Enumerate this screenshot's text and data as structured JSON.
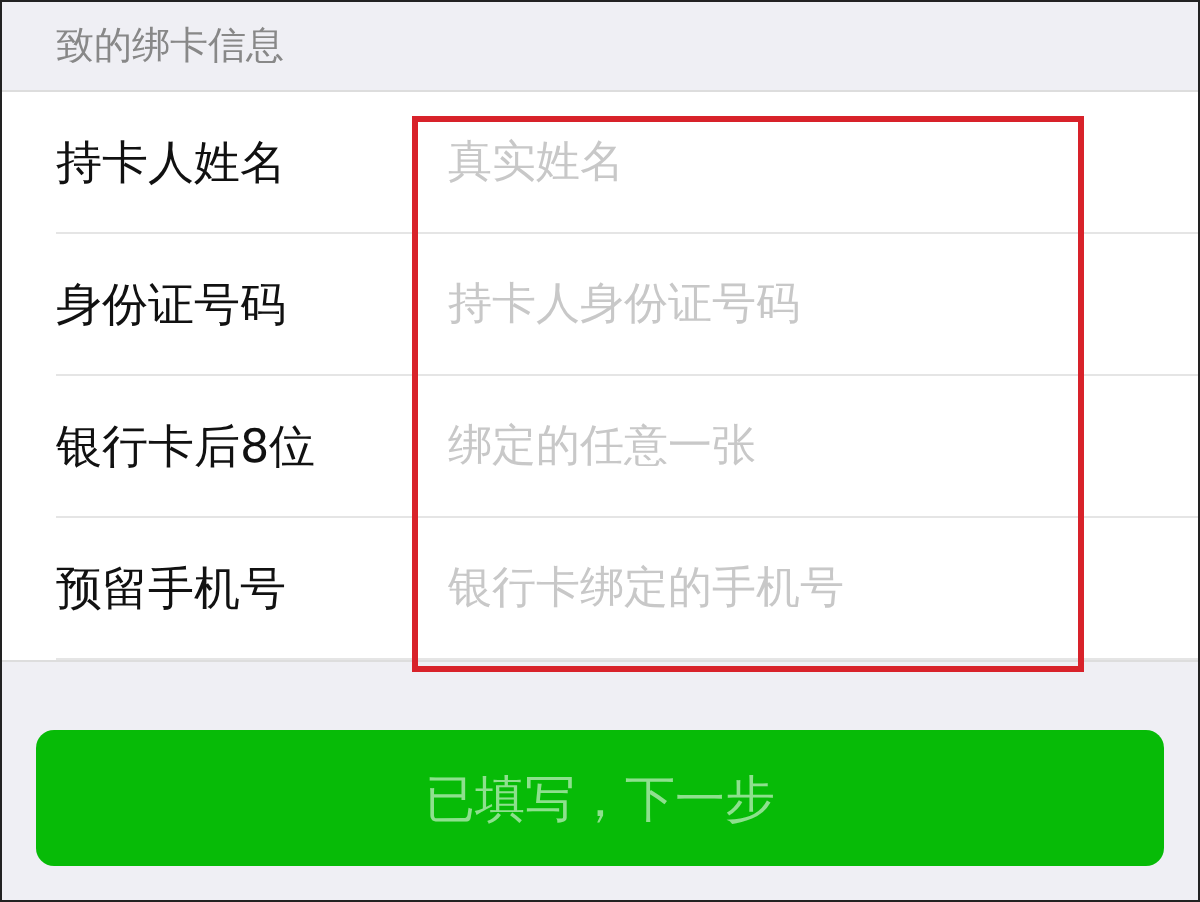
{
  "section_header": "致的绑卡信息",
  "fields": [
    {
      "label": "持卡人姓名",
      "placeholder": "真实姓名"
    },
    {
      "label": "身份证号码",
      "placeholder": "持卡人身份证号码"
    },
    {
      "label": "银行卡后8位",
      "placeholder": "绑定的任意一张"
    },
    {
      "label": "预留手机号",
      "placeholder": "银行卡绑定的手机号"
    }
  ],
  "next_button": {
    "label": "已填写，下一步",
    "disabled": true
  }
}
